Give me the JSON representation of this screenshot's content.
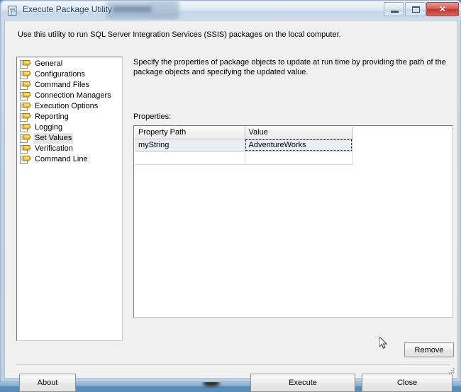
{
  "window": {
    "title": "Execute Package Utility",
    "icon": "package-document-icon",
    "controls": {
      "minimize": "minimize-button",
      "maximize": "maximize-button",
      "close_glyph": "✕"
    }
  },
  "header": {
    "description": "Use this utility to run SQL Server Integration Services (SSIS) packages on the local computer."
  },
  "sidebar": {
    "items": [
      {
        "label": "General",
        "selected": false
      },
      {
        "label": "Configurations",
        "selected": false
      },
      {
        "label": "Command Files",
        "selected": false
      },
      {
        "label": "Connection Managers",
        "selected": false
      },
      {
        "label": "Execution Options",
        "selected": false
      },
      {
        "label": "Reporting",
        "selected": false
      },
      {
        "label": "Logging",
        "selected": false
      },
      {
        "label": "Set Values",
        "selected": true
      },
      {
        "label": "Verification",
        "selected": false
      },
      {
        "label": "Command Line",
        "selected": false
      }
    ]
  },
  "main": {
    "description": "Specify the properties of package objects to update at run time by providing the path of the package objects and specifying the updated value.",
    "properties_label": "Properties:",
    "grid": {
      "columns": [
        "Property Path",
        "Value"
      ],
      "rows": [
        {
          "property_path": "myString",
          "value": "AdventureWorks",
          "selected": true,
          "focused_cell": "value"
        },
        {
          "property_path": "",
          "value": "",
          "selected": false,
          "focused_cell": null
        }
      ]
    },
    "remove_label": "Remove"
  },
  "footer": {
    "about_label": "About",
    "execute_label": "Execute",
    "close_label": "Close"
  },
  "colors": {
    "accent": "#3b6ea5",
    "close_button": "#c0332c",
    "selection": "#e8eef4",
    "client_bg": "#f0f0f0"
  }
}
